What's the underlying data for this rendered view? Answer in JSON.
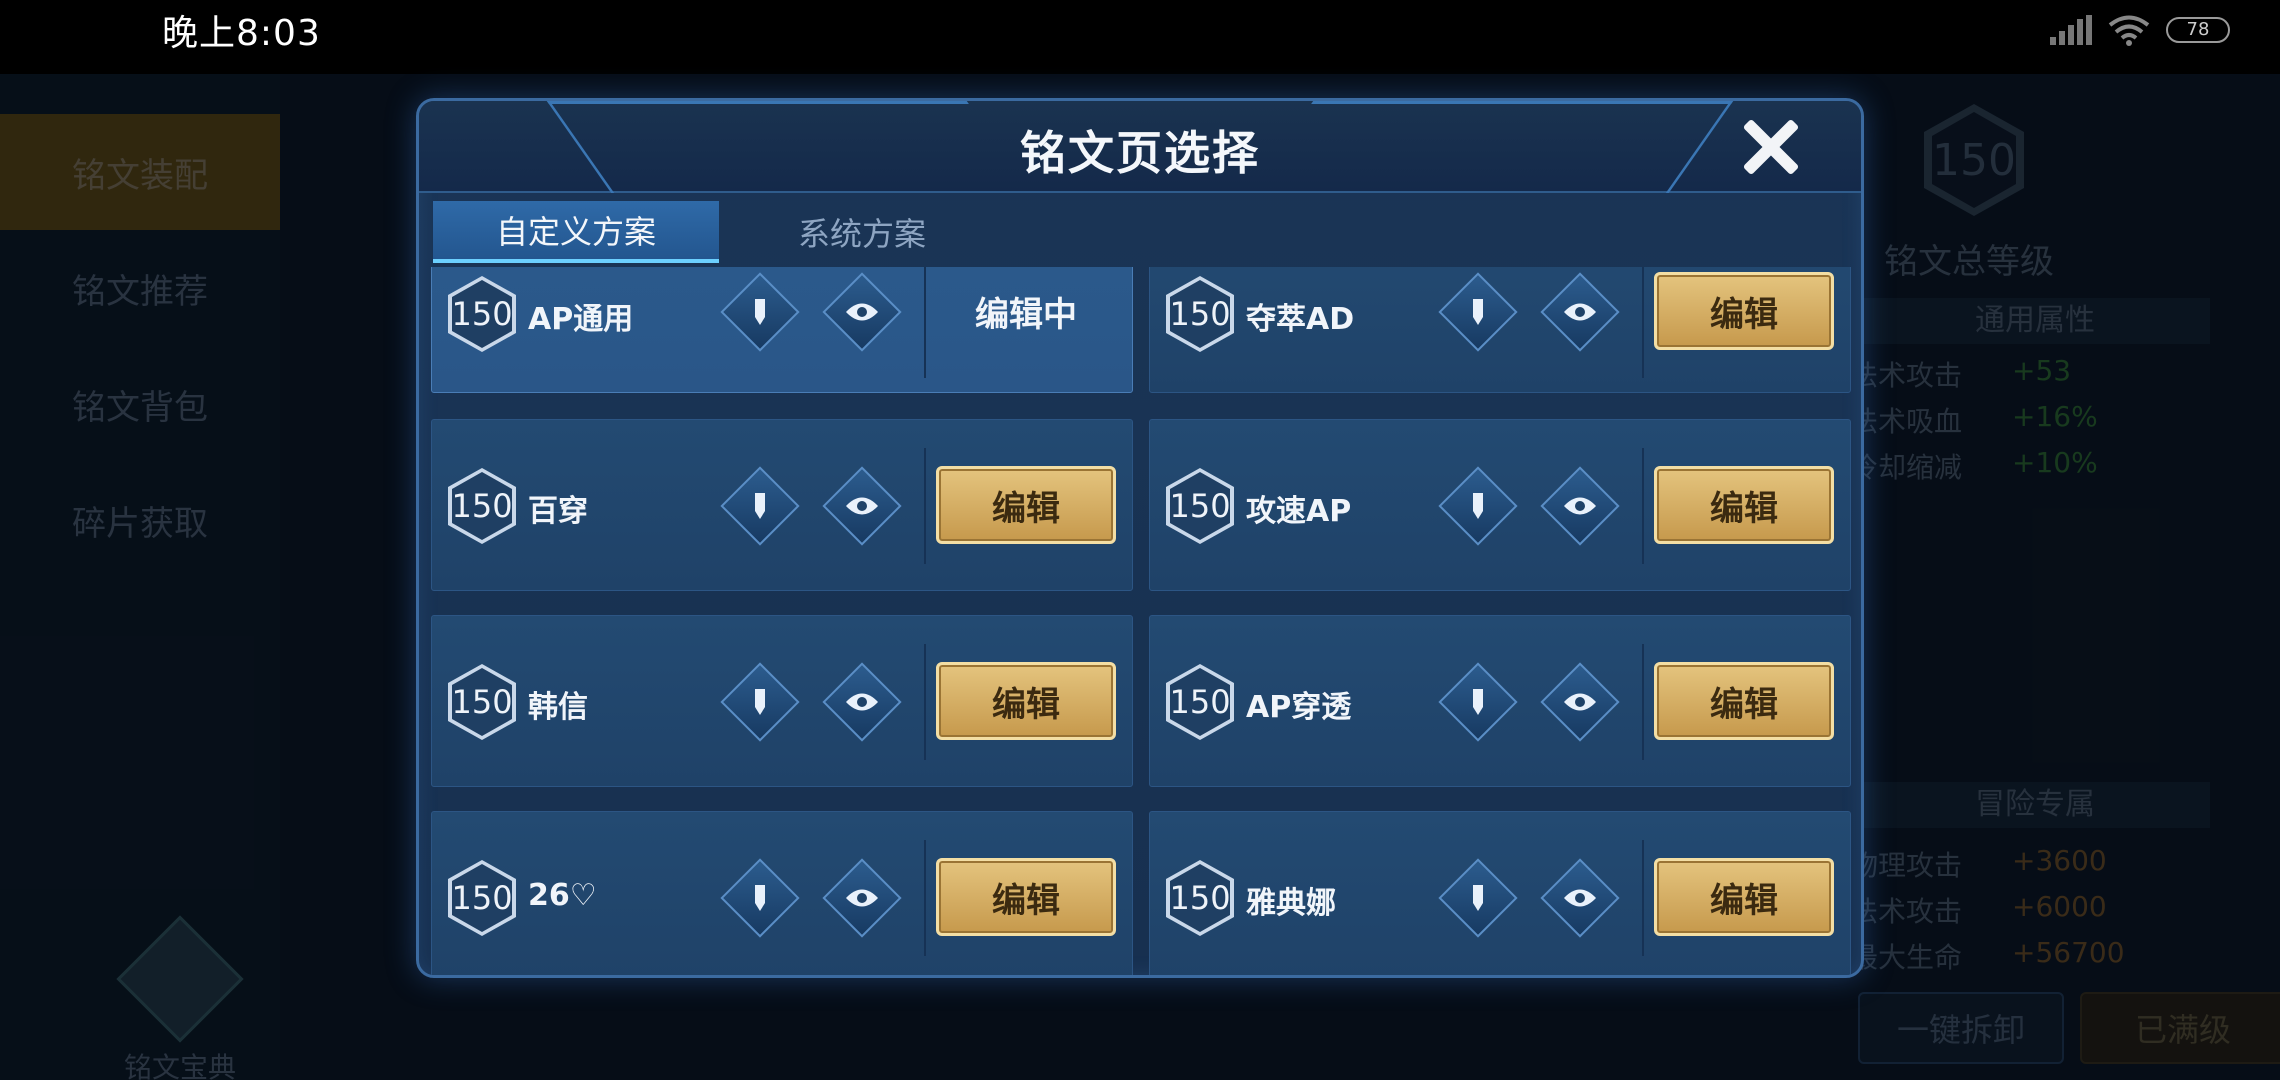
{
  "status_bar": {
    "time": "晚上8:03",
    "battery": "78"
  },
  "background": {
    "nav": [
      "铭文装配",
      "铭文推荐",
      "铭文背包",
      "碎片获取"
    ],
    "codex_label": "铭文宝典",
    "level": "150",
    "level_label": "铭文总等级",
    "general_title": "通用属性",
    "general_attrs": [
      {
        "name": "法术攻击",
        "value": "+53"
      },
      {
        "name": "法术吸血",
        "value": "+16%"
      },
      {
        "name": "冷却缩减",
        "value": "+10%"
      }
    ],
    "adventure_title": "冒险专属",
    "adventure_attrs": [
      {
        "name": "物理攻击",
        "value": "+3600"
      },
      {
        "name": "法术攻击",
        "value": "+6000"
      },
      {
        "name": "最大生命",
        "value": "+56700"
      }
    ],
    "unload_button": "一键拆卸",
    "maxed_button": "已满级"
  },
  "modal": {
    "title": "铭文页选择",
    "tabs": [
      "自定义方案",
      "系统方案"
    ],
    "edit_label": "编辑",
    "editing_label": "编辑中",
    "plans": [
      {
        "level": "150",
        "name": "AP通用",
        "editing": true
      },
      {
        "level": "150",
        "name": "夺萃AD",
        "editing": false
      },
      {
        "level": "150",
        "name": "百穿",
        "editing": false
      },
      {
        "level": "150",
        "name": "攻速AP",
        "editing": false
      },
      {
        "level": "150",
        "name": "韩信",
        "editing": false
      },
      {
        "level": "150",
        "name": "AP穿透",
        "editing": false
      },
      {
        "level": "150",
        "name": "26♡",
        "editing": false
      },
      {
        "level": "150",
        "name": "雅典娜",
        "editing": false
      }
    ]
  },
  "icons": [
    "signal-icon",
    "wifi-icon",
    "battery-icon",
    "close-icon",
    "pencil-icon",
    "eye-icon",
    "book-icon"
  ]
}
